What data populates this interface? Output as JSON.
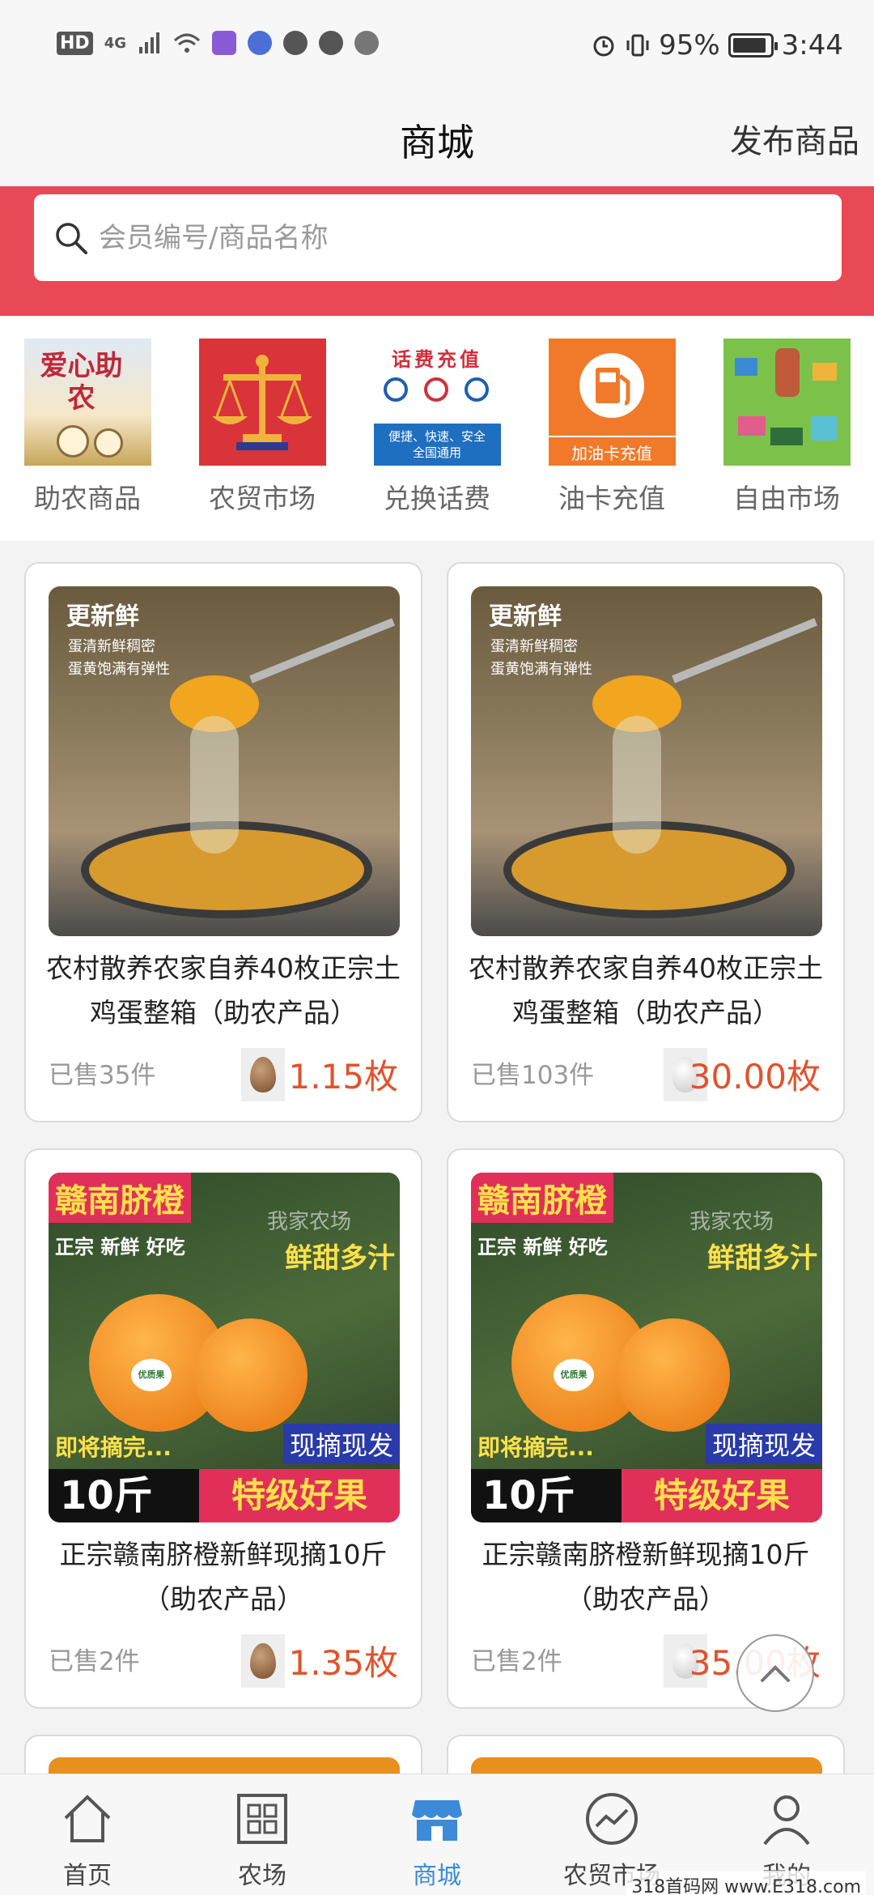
{
  "status_bar": {
    "battery": "95%",
    "time": "3:44",
    "network": "4G",
    "hd": "HD"
  },
  "header": {
    "title": "商城",
    "publish_label": "发布商品"
  },
  "search": {
    "placeholder": "会员编号/商品名称"
  },
  "categories": [
    {
      "label": "助农商品",
      "thumb_text": "爱心助农"
    },
    {
      "label": "农贸市场"
    },
    {
      "label": "兑换话费",
      "thumb_text": "话费充值",
      "thumb_sub": "便捷、快速、安全 全国通用"
    },
    {
      "label": "油卡充值",
      "thumb_text": "加油卡充值"
    },
    {
      "label": "自由市场"
    }
  ],
  "products": [
    {
      "name": "农村散养农家自养40枚正宗土鸡蛋整箱（助农产品）",
      "sold": "已售35件",
      "price": "1.15枚",
      "coin": "brown-egg",
      "img_title": "更新鲜",
      "img_sub1": "蛋清新鲜稠密",
      "img_sub2": "蛋黄饱满有弹性"
    },
    {
      "name": "农村散养农家自养40枚正宗土鸡蛋整箱（助农产品）",
      "sold": "已售103件",
      "price": "30.00枚",
      "coin": "white-egg",
      "img_title": "更新鲜",
      "img_sub1": "蛋清新鲜稠密",
      "img_sub2": "蛋黄饱满有弹性"
    },
    {
      "name": "正宗赣南脐橙新鲜现摘10斤（助农产品）",
      "sold": "已售2件",
      "price": "1.35枚",
      "coin": "brown-egg",
      "img_title": "赣南脐橙",
      "img_sub1": "正宗 新鲜 好吃",
      "img_sub2": "鲜甜多汁",
      "img_tag1": "即将摘完...",
      "img_tag2": "现摘现发",
      "img_weight": "10斤",
      "img_grade": "特级好果",
      "img_farm": "我家农场",
      "img_sticker": "优质果"
    },
    {
      "name": "正宗赣南脐橙新鲜现摘10斤（助农产品）",
      "sold": "已售2件",
      "price": "35.00枚",
      "coin": "white-egg",
      "img_title": "赣南脐橙",
      "img_sub1": "正宗 新鲜 好吃",
      "img_sub2": "鲜甜多汁",
      "img_tag1": "即将摘完...",
      "img_tag2": "现摘现发",
      "img_weight": "10斤",
      "img_grade": "特级好果",
      "img_farm": "我家农场",
      "img_sticker": "优质果"
    }
  ],
  "bottom_nav": [
    {
      "label": "首页",
      "icon": "home-icon"
    },
    {
      "label": "农场",
      "icon": "grid-icon"
    },
    {
      "label": "商城",
      "icon": "shop-icon",
      "active": true
    },
    {
      "label": "农贸市场",
      "icon": "trend-icon"
    },
    {
      "label": "我的",
      "icon": "user-icon"
    }
  ],
  "watermark": "318首码网 www.E318.com",
  "colors": {
    "accent_red": "#e94956",
    "price": "#e0532d",
    "active_nav": "#3d8bd8"
  }
}
